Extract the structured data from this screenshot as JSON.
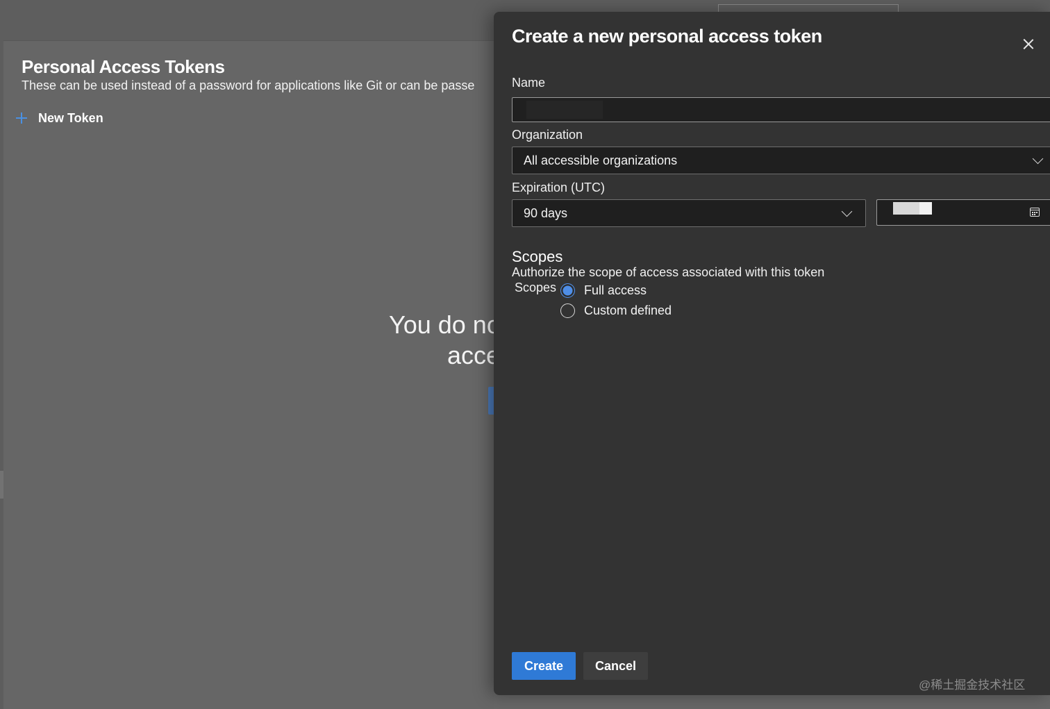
{
  "background_page": {
    "title": "Personal Access Tokens",
    "subtitle": "These can be used instead of a password for applications like Git or can be passe",
    "new_token_label": "New Token",
    "plus_icon": "plus-icon",
    "empty_line1": "You do no",
    "empty_line2": "acce"
  },
  "dialog": {
    "title": "Create a new personal access token",
    "close_icon": "close-icon",
    "name": {
      "label": "Name",
      "value": ""
    },
    "organization": {
      "label": "Organization",
      "selected": "All accessible organizations"
    },
    "expiration": {
      "label": "Expiration (UTC)",
      "selected": "90 days",
      "date_value": ""
    },
    "scopes": {
      "heading": "Scopes",
      "description": "Authorize the scope of access associated with this token",
      "label": "Scopes",
      "options": [
        {
          "label": "Full access",
          "checked": true
        },
        {
          "label": "Custom defined",
          "checked": false
        }
      ]
    },
    "buttons": {
      "create": "Create",
      "cancel": "Cancel"
    }
  },
  "watermark": "@稀土掘金技术社区",
  "colors": {
    "accent": "#2f7ad6",
    "panel_bg": "#333333",
    "input_bg": "#1f1f1f"
  }
}
